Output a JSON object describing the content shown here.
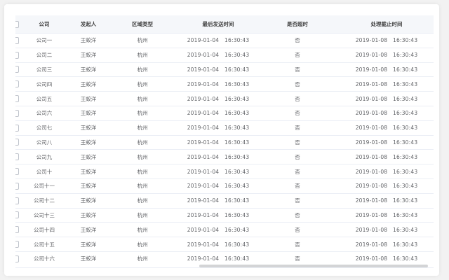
{
  "table": {
    "columns": [
      "公司",
      "发起人",
      "区域类型",
      "最后发送时间",
      "是否超时",
      "处理截止时间"
    ],
    "rows": [
      {
        "company": "公司一",
        "initiator": "王蛟洋",
        "region": "杭州",
        "last_sent": "2019-01-04   16:30:43",
        "timeout": "否",
        "deadline": "2019-01-08   16:30:43"
      },
      {
        "company": "公司二",
        "initiator": "王蛟洋",
        "region": "杭州",
        "last_sent": "2019-01-04   16:30:43",
        "timeout": "否",
        "deadline": "2019-01-08   16:30:43"
      },
      {
        "company": "公司三",
        "initiator": "王蛟洋",
        "region": "杭州",
        "last_sent": "2019-01-04   16:30:43",
        "timeout": "否",
        "deadline": "2019-01-08   16:30:43"
      },
      {
        "company": "公司四",
        "initiator": "王蛟洋",
        "region": "杭州",
        "last_sent": "2019-01-04   16:30:43",
        "timeout": "否",
        "deadline": "2019-01-08   16:30:43"
      },
      {
        "company": "公司五",
        "initiator": "王蛟洋",
        "region": "杭州",
        "last_sent": "2019-01-04   16:30:43",
        "timeout": "否",
        "deadline": "2019-01-08   16:30:43"
      },
      {
        "company": "公司六",
        "initiator": "王蛟洋",
        "region": "杭州",
        "last_sent": "2019-01-04   16:30:43",
        "timeout": "否",
        "deadline": "2019-01-08   16:30:43"
      },
      {
        "company": "公司七",
        "initiator": "王蛟洋",
        "region": "杭州",
        "last_sent": "2019-01-04   16:30:43",
        "timeout": "否",
        "deadline": "2019-01-08   16:30:43"
      },
      {
        "company": "公司八",
        "initiator": "王蛟洋",
        "region": "杭州",
        "last_sent": "2019-01-04   16:30:43",
        "timeout": "否",
        "deadline": "2019-01-08   16:30:43"
      },
      {
        "company": "公司九",
        "initiator": "王蛟洋",
        "region": "杭州",
        "last_sent": "2019-01-04   16:30:43",
        "timeout": "否",
        "deadline": "2019-01-08   16:30:43"
      },
      {
        "company": "公司十",
        "initiator": "王蛟洋",
        "region": "杭州",
        "last_sent": "2019-01-04   16:30:43",
        "timeout": "否",
        "deadline": "2019-01-08   16:30:43"
      },
      {
        "company": "公司十一",
        "initiator": "王蛟洋",
        "region": "杭州",
        "last_sent": "2019-01-04   16:30:43",
        "timeout": "否",
        "deadline": "2019-01-08   16:30:43"
      },
      {
        "company": "公司十二",
        "initiator": "王蛟洋",
        "region": "杭州",
        "last_sent": "2019-01-04   16:30:43",
        "timeout": "否",
        "deadline": "2019-01-08   16:30:43"
      },
      {
        "company": "公司十三",
        "initiator": "王蛟洋",
        "region": "杭州",
        "last_sent": "2019-01-04   16:30:43",
        "timeout": "否",
        "deadline": "2019-01-08   16:30:43"
      },
      {
        "company": "公司十四",
        "initiator": "王蛟洋",
        "region": "杭州",
        "last_sent": "2019-01-04   16:30:43",
        "timeout": "否",
        "deadline": "2019-01-08   16:30:43"
      },
      {
        "company": "公司十五",
        "initiator": "王蛟洋",
        "region": "杭州",
        "last_sent": "2019-01-04   16:30:43",
        "timeout": "否",
        "deadline": "2019-01-08   16:30:43"
      },
      {
        "company": "公司十六",
        "initiator": "王蛟洋",
        "region": "杭州",
        "last_sent": "2019-01-04   16:30:43",
        "timeout": "否",
        "deadline": "2019-01-08   16:30:43"
      }
    ]
  }
}
